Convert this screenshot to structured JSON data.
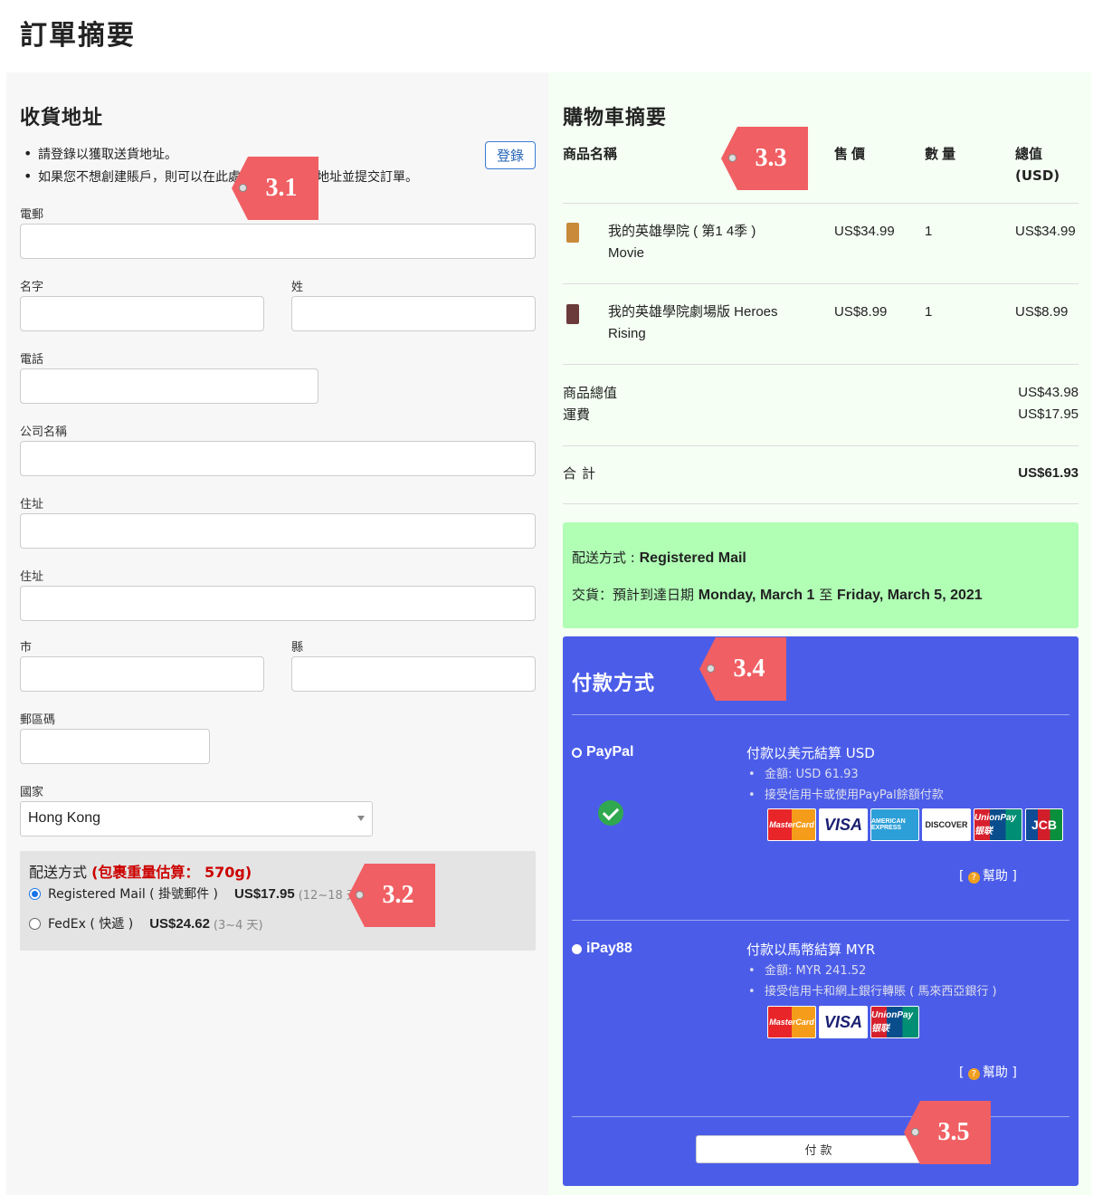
{
  "page": {
    "title": "訂單摘要"
  },
  "address": {
    "heading": "收貨地址",
    "notes": [
      "請登錄以獲取送貨地址。",
      "如果您不想創建賬戶，則可以在此處輸入您的送貨地址並提交訂單。"
    ],
    "login_label": "登錄",
    "fields": {
      "email": "電郵",
      "first_name": "名字",
      "last_name": "姓",
      "phone": "電話",
      "company": "公司名稱",
      "address1": "住址",
      "address2": "住址",
      "city": "市",
      "county": "縣",
      "postcode": "郵區碼",
      "country": "國家"
    },
    "country_value": "Hong Kong"
  },
  "shipping": {
    "title": "配送方式",
    "weight_note": "(包裹重量估算： 570g)",
    "options": [
      {
        "label": "Registered Mail ( 掛號郵件 )",
        "price": "US$17.95",
        "days": "(12~18 天)",
        "selected": true
      },
      {
        "label": "FedEx ( 快遞 )",
        "price": "US$24.62",
        "days": "(3~4 天)",
        "selected": false
      }
    ]
  },
  "cart": {
    "heading": "購物車摘要",
    "columns": [
      "商品名稱",
      "售價",
      "數量",
      "總值",
      "(USD)"
    ],
    "items": [
      {
        "name": "我的英雄學院 ( 第1 4季 )",
        "name2": "Movie",
        "price": "US$34.99",
        "qty": "1",
        "total": "US$34.99",
        "thumb_color": "#c98a3a"
      },
      {
        "name": "我的英雄學院劇場版 Heroes",
        "name2": "Rising",
        "price": "US$8.99",
        "qty": "1",
        "total": "US$8.99",
        "thumb_color": "#6b3a3a"
      }
    ],
    "subtotal_label": "商品總值",
    "subtotal": "US$43.98",
    "shipping_label": "運費",
    "shipping": "US$17.95",
    "total_label": "合計",
    "total": "US$61.93"
  },
  "delivery": {
    "method_label": "配送方式 :",
    "method": "Registered Mail",
    "eta_label": "交貨：預計到達日期",
    "eta_from": "Monday, March 1",
    "eta_to_word": "至",
    "eta_to": "Friday, March 5, 2021"
  },
  "payment": {
    "heading": "付款方式",
    "methods": [
      {
        "name": "PayPal",
        "desc": "付款以美元結算 USD",
        "amount": "金額: USD 61.93",
        "note": "接受信用卡或使用PayPal餘額付款",
        "help": "幫助"
      },
      {
        "name": "iPay88",
        "desc": "付款以馬幣結算 MYR",
        "amount": "金額: MYR 241.52",
        "note": "接受信用卡和網上銀行轉賬 ( 馬來西亞銀行 )",
        "help": "幫助"
      }
    ],
    "cards": {
      "mastercard": "MasterCard",
      "visa": "VISA",
      "amex": "AMERICAN EXPRESS",
      "discover": "DISCOVER",
      "unionpay": "UnionPay 银联",
      "jcb": "JCB"
    },
    "pay_button": "付款",
    "accent": "#4b5de8"
  },
  "annotations": [
    "3.1",
    "3.2",
    "3.3",
    "3.4",
    "3.5"
  ]
}
